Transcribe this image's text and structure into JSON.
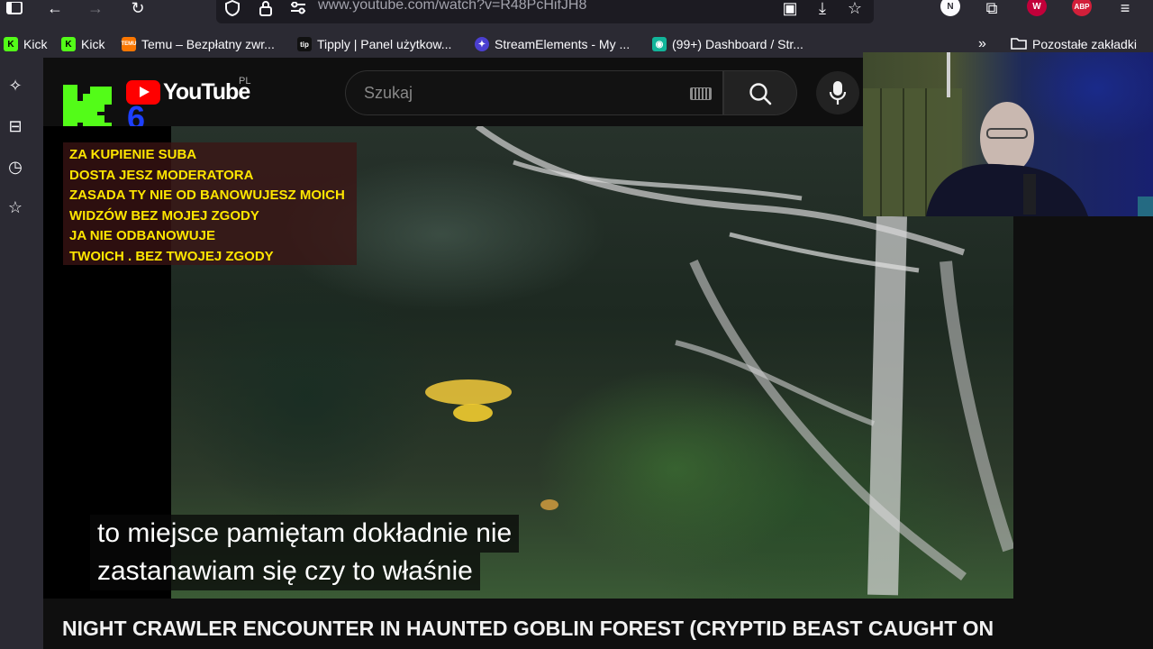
{
  "browser": {
    "url": "www.youtube.com/watch?v=R48PcHifJH8",
    "account_initial": "N",
    "abp_label": "ABP"
  },
  "bookmarks": [
    {
      "label": "Kick",
      "icon": "kick-icon"
    },
    {
      "label": "Kick",
      "icon": "kick-icon"
    },
    {
      "label": "Temu – Bezpłatny zwr...",
      "icon": "temu-icon"
    },
    {
      "label": "Tipply | Panel użytkow...",
      "icon": "tipply-icon"
    },
    {
      "label": "StreamElements - My ...",
      "icon": "streamelements-icon"
    },
    {
      "label": "(99+) Dashboard / Str...",
      "icon": "discord-icon"
    }
  ],
  "bookmarks_more": "Pozostałe zakładki",
  "youtube": {
    "logo_text": "YouTube",
    "region": "PL",
    "search_placeholder": "Szukaj"
  },
  "channel_logo": {
    "digit": "6"
  },
  "overlay_lines": [
    "ZA KUPIENIE SUBA",
    "DOSTA JESZ MODERATORA",
    "ZASADA  TY NIE OD BANOWUJESZ MOICH",
    "WIDZÓW BEZ MOJEJ ZGODY",
    "JA NIE ODBANOWUJE",
    "TWOICH . BEZ TWOJEJ ZGODY"
  ],
  "subtitles": [
    "to miejsce pamiętam dokładnie nie",
    "zastanawiam się czy to właśnie"
  ],
  "video_title": "NIGHT CRAWLER ENCOUNTER IN HAUNTED GOBLIN FOREST (CRYPTID BEAST CAUGHT ON",
  "colors": {
    "overlay_text": "#ffe600",
    "youtube_red": "#ff0000",
    "kick_green": "#53fc18"
  }
}
